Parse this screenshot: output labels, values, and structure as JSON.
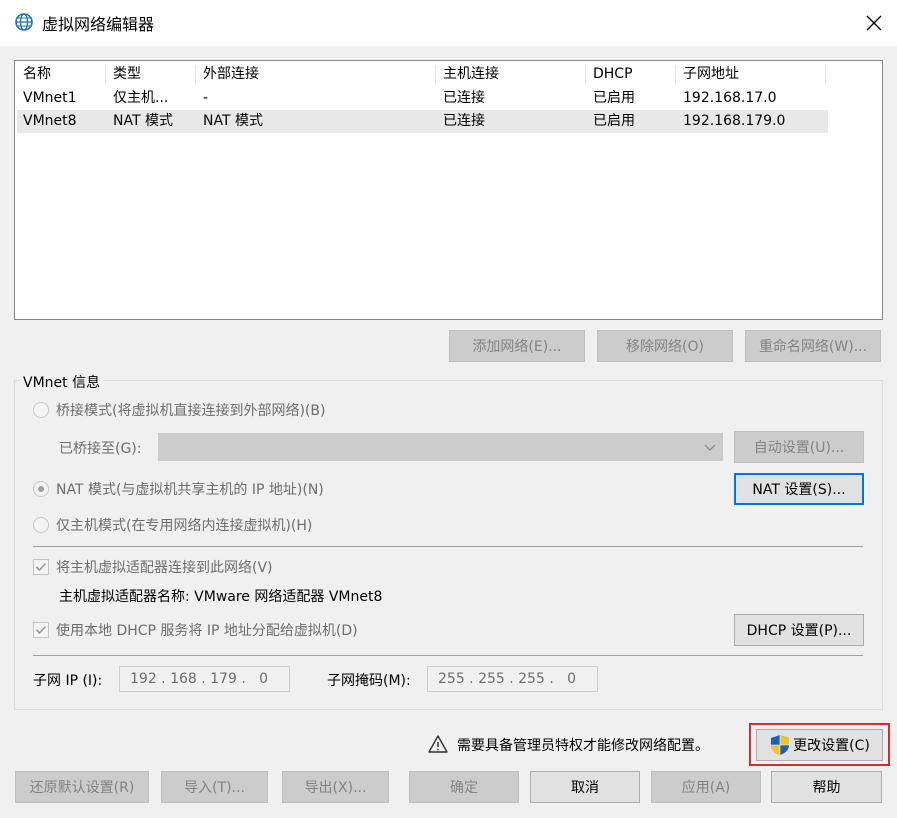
{
  "window": {
    "title": "虚拟网络编辑器",
    "icon": "globe-icon",
    "close_icon": "close-icon"
  },
  "network_list": {
    "columns": [
      "名称",
      "类型",
      "外部连接",
      "主机连接",
      "DHCP",
      "子网地址"
    ],
    "rows": [
      {
        "name": "VMnet1",
        "type": "仅主机...",
        "external": "-",
        "host": "已连接",
        "dhcp": "已启用",
        "subnet": "192.168.17.0",
        "selected": false
      },
      {
        "name": "VMnet8",
        "type": "NAT 模式",
        "external": "NAT 模式",
        "host": "已连接",
        "dhcp": "已启用",
        "subnet": "192.168.179.0",
        "selected": true
      }
    ]
  },
  "list_buttons": {
    "add": "添加网络(E)...",
    "remove": "移除网络(O)",
    "rename": "重命名网络(W)..."
  },
  "vmnet_info": {
    "group_label": "VMnet 信息",
    "bridge_radio": "桥接模式(将虚拟机直接连接到外部网络)(B)",
    "bridged_to_label": "已桥接至(G):",
    "bridged_to_value": "",
    "auto_settings": "自动设置(U)...",
    "nat_radio": "NAT 模式(与虚拟机共享主机的 IP 地址)(N)",
    "nat_settings": "NAT 设置(S)...",
    "hostonly_radio": "仅主机模式(在专用网络内连接虚拟机)(H)",
    "selected_mode": "nat",
    "connect_adapter_check": "将主机虚拟适配器连接到此网络(V)",
    "connect_adapter_checked": true,
    "adapter_name_text": "主机虚拟适配器名称: VMware 网络适配器 VMnet8",
    "dhcp_check": "使用本地 DHCP 服务将 IP 地址分配给虚拟机(D)",
    "dhcp_checked": true,
    "dhcp_settings": "DHCP 设置(P)...",
    "subnet_ip_label": "子网 IP (I):",
    "subnet_ip_value": "192 . 168 . 179 .   0",
    "subnet_mask_label": "子网掩码(M):",
    "subnet_mask_value": "255 . 255 . 255 .   0"
  },
  "admin": {
    "warning_icon": "warning-icon",
    "warning_text": "需要具备管理员特权才能修改网络配置。",
    "change_settings": "更改设置(C)",
    "shield_icon": "uac-shield-icon",
    "highlight_color": "#d32f2f"
  },
  "footer_buttons": {
    "restore": "还原默认设置(R)",
    "import": "导入(T)...",
    "export": "导出(X)...",
    "ok": "确定",
    "cancel": "取消",
    "apply": "应用(A)",
    "help": "帮助"
  }
}
